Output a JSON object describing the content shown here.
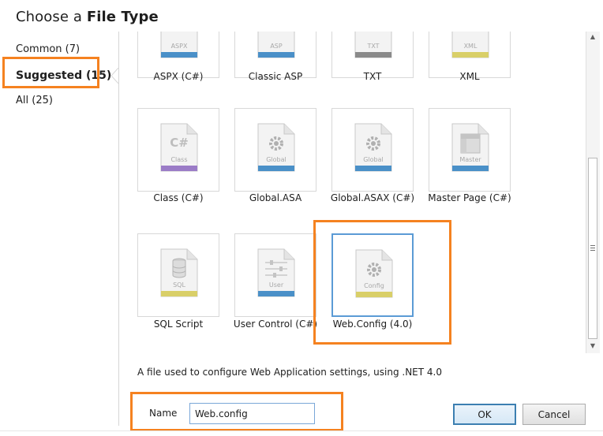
{
  "dialog": {
    "title_prefix": "Choose a ",
    "title_bold": "File Type"
  },
  "categories": [
    {
      "label": "Common (7)"
    },
    {
      "label": "Suggested (15)"
    },
    {
      "label": "All (25)"
    }
  ],
  "tiles": [
    {
      "label": "ASPX (C#)",
      "icon_text": "ASPX",
      "band": "#4a90c8"
    },
    {
      "label": "Classic ASP",
      "icon_text": "ASP",
      "band": "#4a90c8"
    },
    {
      "label": "TXT",
      "icon_text": "TXT",
      "band": "#8a8a8a"
    },
    {
      "label": "XML",
      "icon_text": "XML",
      "band": "#d9cf68"
    },
    {
      "label": "Class (C#)",
      "icon_text": "Class",
      "glyph": "C#",
      "band": "#9b7cc7"
    },
    {
      "label": "Global.ASA",
      "icon_text": "Global",
      "band": "#4a90c8"
    },
    {
      "label": "Global.ASAX (C#)",
      "icon_text": "Global",
      "band": "#4a90c8"
    },
    {
      "label": "Master Page (C#)",
      "icon_text": "Master",
      "band": "#4a90c8"
    },
    {
      "label": "SQL Script",
      "icon_text": "SQL",
      "band": "#d9cf68"
    },
    {
      "label": "User Control (C#)",
      "icon_text": "User",
      "band": "#4a90c8"
    },
    {
      "label": "Web.Config (4.0)",
      "icon_text": "Config",
      "band": "#d9cf68"
    }
  ],
  "description": "A file used to configure Web Application settings, using .NET 4.0",
  "name_field": {
    "label": "Name",
    "value": "Web.config"
  },
  "buttons": {
    "ok": "OK",
    "cancel": "Cancel"
  },
  "colors": {
    "highlight": "#f58220",
    "selection": "#5b9bd5"
  }
}
